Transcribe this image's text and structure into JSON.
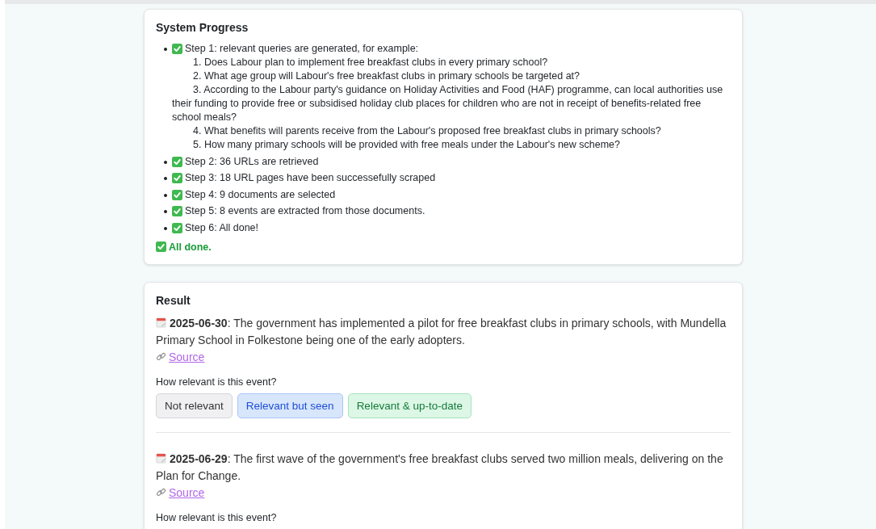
{
  "progress": {
    "title": "System Progress",
    "steps": [
      {
        "text": "Step 1: relevant queries are generated, for example:",
        "done": true,
        "queries": [
          "1. Does Labour plan to implement free breakfast clubs in every primary school?",
          "2. What age group will Labour's free breakfast clubs in primary schools be targeted at?",
          "3. According to the Labour party's guidance on Holiday Activities and Food (HAF) programme, can local authorities use their funding to provide free or subsidised holiday club places for children who are not in receipt of benefits-related free school meals?",
          "4. What benefits will parents receive from the Labour's proposed free breakfast clubs in primary schools?",
          "5. How many primary schools will be provided with free meals under the Labour's new scheme?"
        ]
      },
      {
        "text": "Step 2: 36 URLs are retrieved",
        "done": true
      },
      {
        "text": "Step 3: 18 URL pages have been successefully scraped",
        "done": true
      },
      {
        "text": "Step 4: 9 documents are selected",
        "done": true
      },
      {
        "text": "Step 5: 8 events are extracted from those documents.",
        "done": true
      },
      {
        "text": "Step 6: All done!",
        "done": true
      }
    ],
    "status": {
      "text": "All done.",
      "done": true
    }
  },
  "result": {
    "title": "Result",
    "events": [
      {
        "date": "2025-06-30",
        "text": ": The government has implemented a pilot for free breakfast clubs in primary schools, with Mundella Primary School in Folkestone being one of the early adopters.",
        "link": "Source",
        "question": "How relevant is this event?",
        "buttons": [
          {
            "label": "Not relevant",
            "kind": "neutral"
          },
          {
            "label": "Relevant but seen",
            "kind": "seen"
          },
          {
            "label": "Relevant & up-to-date",
            "kind": "fresh"
          }
        ]
      },
      {
        "date": "2025-06-29",
        "text": ": The first wave of the government's free breakfast clubs served two million meals, delivering on the Plan for Change.",
        "link": "Source",
        "question": "How relevant is this event?"
      }
    ]
  }
}
